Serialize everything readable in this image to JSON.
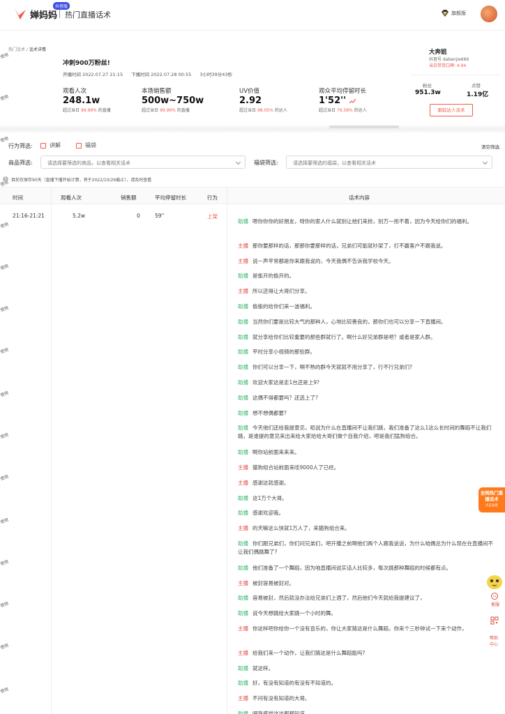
{
  "header": {
    "badge": "抖音版",
    "brand": "婵妈妈",
    "section": "热门直播话术",
    "vip_label": "旗舰版",
    "colors": {
      "accent": "#f05a4a",
      "green": "#2fb56c",
      "promo": "#ff7a1a"
    }
  },
  "watermark": "使用",
  "breadcrumb": {
    "parent": "热门话术",
    "separator": " / ",
    "current": "话术详情"
  },
  "live": {
    "title": "冲刺900万粉丝!",
    "start": "开播时间 2022.07.27 21:15",
    "end": "下播时间 2022.07.28 00:55",
    "duration": "3小时39分43秒"
  },
  "stats": [
    {
      "label": "观看人次",
      "value": "248.1w",
      "cmp_prefix": "超过当日",
      "cmp_pct": "99.99%",
      "cmp_suffix": "的直播"
    },
    {
      "label": "本场销售额",
      "value": "500w~750w",
      "cmp_prefix": "超过当日",
      "cmp_pct": "99.99%",
      "cmp_suffix": "的直播"
    },
    {
      "label": "UV价值",
      "value": "2.92",
      "cmp_prefix": "超过当日",
      "cmp_pct": "98.05%",
      "cmp_suffix": "的达人"
    },
    {
      "label": "观众平均停留时长",
      "value": "1'52''",
      "cmp_prefix": "超过当日",
      "cmp_pct": "76.58%",
      "cmp_suffix": "的达人"
    }
  ],
  "anchor": {
    "name": "大奔姐",
    "douyin_id": "抖音号 dabenjie666",
    "score": "当日带货口碑: 4.94",
    "fans_label": "粉丝",
    "fans_value": "951.3w",
    "likes_label": "点赞",
    "likes_value": "1.19亿",
    "follow_button": "跟踪达人话术"
  },
  "filters": {
    "behavior_label": "行为筛选:",
    "options": [
      "讲解",
      "福袋"
    ],
    "clear": "清空筛选",
    "product_label": "商品筛选:",
    "product_placeholder": "请选择要筛选的商品，以查看相关话术",
    "bag_label": "福袋筛选:",
    "bag_placeholder": "请选择要筛选的福袋，以查看相关话术",
    "note": "目前仅保存90天（直播下播开始计算，将于2022/10/26截止），请及时查看"
  },
  "table": {
    "headers": [
      "时间",
      "观看人次",
      "销售额",
      "平均停留时长",
      "行为",
      "话术内容"
    ],
    "row": {
      "time": "21:16-21:21",
      "views": "5.2w",
      "sales": "0",
      "stay": "59''",
      "action": "上架"
    }
  },
  "script": [
    {
      "role": "助播",
      "type": "assist",
      "text": "嗯你你你的好朋友，呀你的家人什么就别让他们来抢，别万一抢不着，因为今天给你们的福利。"
    },
    {
      "role": "主播",
      "type": "host",
      "text": "那你要那样的话，那那你要那样的话，兄弟们可能就吵架了，打不赢客户不跟我说。"
    },
    {
      "role": "主播",
      "type": "host",
      "text": "说一声平常都是你来跟我说的，今天我偶不告诉我学校今天。"
    },
    {
      "role": "助播",
      "type": "assist",
      "text": "是偷开的偷开的。"
    },
    {
      "role": "主播",
      "type": "host",
      "text": "所以还得让大哥们分享。"
    },
    {
      "role": "助播",
      "type": "assist",
      "text": "偷偷的给你们来一波福利。"
    },
    {
      "role": "助播",
      "type": "assist",
      "text": "当然你们要是比较大气的那种人，心地比较善良的，那你们也可以分享一下直播间。"
    },
    {
      "role": "助播",
      "type": "assist",
      "text": "就分享给你们比较重要的那些群就行了。啊什么好兄弟群是吧？或者是家人群。"
    },
    {
      "role": "助播",
      "type": "assist",
      "text": "平时分享小视频的那些群。"
    },
    {
      "role": "助播",
      "type": "assist",
      "text": "你们可以分享一下，啊不熟的群今天就就不用分享了，行不行兄弟们?"
    },
    {
      "role": "助播",
      "type": "assist",
      "text": "欢迎大家这是走1台还是上9?"
    },
    {
      "role": "助播",
      "type": "assist",
      "text": "这偶不得都要吗？还选上了?"
    },
    {
      "role": "助播",
      "type": "assist",
      "text": "想不想偶都要?"
    },
    {
      "role": "助播",
      "type": "assist",
      "text": "今天他们还给我提意见，呃说为什么在直播间不让我们跳，我们准备了这么1这么长时间的舞蹈不让我们跳，是谁提的意见来出来给大家给给大哥们做个自我介绍，吧是我们猛狗组合。"
    },
    {
      "role": "助播",
      "type": "assist",
      "text": "啊你站前面来来来。"
    },
    {
      "role": "主播",
      "type": "host",
      "text": "猫狗组合站前面来哇9000人了已经。"
    },
    {
      "role": "主播",
      "type": "host",
      "text": "感谢这就感谢。"
    },
    {
      "role": "助播",
      "type": "assist",
      "text": "这1万个大哥。"
    },
    {
      "role": "助播",
      "type": "assist",
      "text": "感谢欢迎我。"
    },
    {
      "role": "主播",
      "type": "host",
      "text": "的天嘛这么快就1万人了，来猫狗组合来。"
    },
    {
      "role": "助播",
      "type": "assist",
      "text": "你们跟兄弟们，你们问兄弟们，吧开播之前啊他们两个人跟我说说，为什么咱偶总为什么现在在直播间不让我们偶跳舞了?"
    },
    {
      "role": "助播",
      "type": "assist",
      "text": "他们准备了一个舞蹈，因为咱直播间说实话人比较多，每次跳那种舞蹈的时候都有点。"
    },
    {
      "role": "主播",
      "type": "host",
      "text": "被封容易被封对。"
    },
    {
      "role": "助播",
      "type": "assist",
      "text": "容易被封，然后就没办法给兄弟们上酒了，然后他们今天就给我提建议了，"
    },
    {
      "role": "助播",
      "type": "assist",
      "text": "说今天想跳给大家跳一个小时的舞。"
    },
    {
      "role": "主播",
      "type": "host",
      "text": "你这样吧你给你一个没有音乐的，你让大家猜这是什么舞蹈，你来个三秒钟试一下来个动作，"
    },
    {
      "role": "主播",
      "type": "host",
      "text": "给我们来一个动作，让我们猜这是什么舞蹈能吗?"
    },
    {
      "role": "助播",
      "type": "assist",
      "text": "就这样。"
    },
    {
      "role": "助播",
      "type": "assist",
      "text": "好，有没有知道的有没有不知道的。"
    },
    {
      "role": "主播",
      "type": "host",
      "text": "不问有没有知道的大哥。"
    },
    {
      "role": "助播",
      "type": "assist",
      "text": "吧我感觉这这都都知道。"
    }
  ],
  "sidebar_right": {
    "promo_title": "全网热门直播话术",
    "promo_sub": "点击查看",
    "service": "客服",
    "help": "帮助中心"
  },
  "icons": [
    "logo-icon",
    "vip-diamond-icon",
    "avatar",
    "info-icon",
    "chevron-down-icon",
    "rising-trend-icon",
    "mascot-icon",
    "customer-service-icon",
    "qr-code-icon"
  ]
}
